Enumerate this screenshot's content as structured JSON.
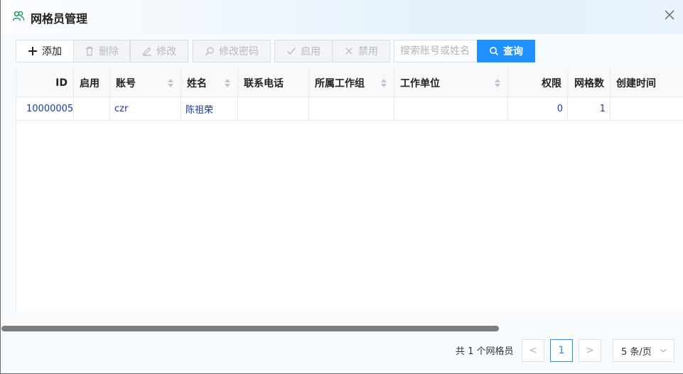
{
  "window": {
    "title": "网格员管理",
    "icon": "users-icon",
    "accent": "#1e90ff"
  },
  "toolbar": {
    "add_label": "添加",
    "delete_label": "删除",
    "edit_label": "修改",
    "password_label": "修改密码",
    "enable_label": "启用",
    "disable_label": "禁用",
    "search_placeholder": "搜索账号或姓名",
    "query_label": "查询"
  },
  "table": {
    "columns": [
      "ID",
      "启用",
      "账号",
      "姓名",
      "联系电话",
      "所属工作组",
      "工作单位",
      "权限",
      "网格数",
      "创建时间"
    ],
    "rows": [
      [
        "10000005",
        "",
        "czr",
        "陈祖荣",
        "",
        "",
        "",
        "0",
        "1",
        ""
      ]
    ]
  },
  "pagination": {
    "total_text": "共 1 个网格员",
    "prev": "<",
    "current_page": "1",
    "next": ">",
    "page_size": "5 条/页"
  }
}
